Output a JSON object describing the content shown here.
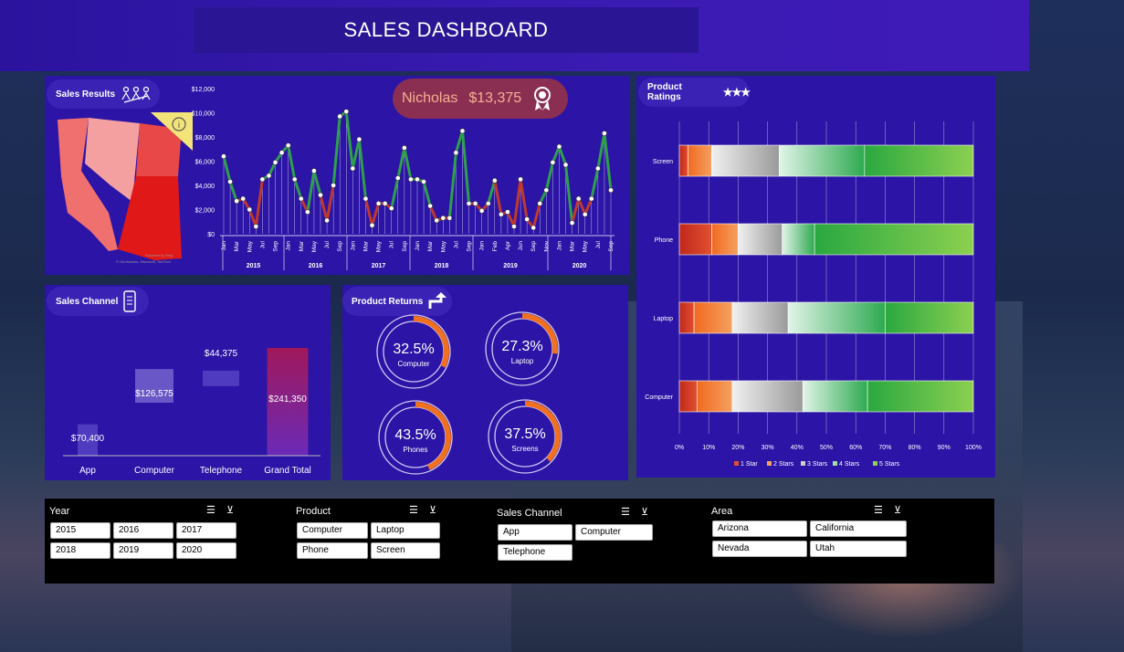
{
  "header": {
    "title": "SALES DASHBOARD"
  },
  "sales_results": {
    "title": "Sales Results",
    "top_performer": {
      "name": "Nicholas",
      "amount": "$13,375"
    },
    "map_credit": "© GeoNames, Microsoft, TomTom",
    "map_credit2": "Powered by Bing",
    "info_icon": "info-icon"
  },
  "chart_data": [
    {
      "type": "line",
      "title": "",
      "ylabel": "",
      "ylim": [
        0,
        12000
      ],
      "yticks": [
        "$0",
        "$2,000",
        "$4,000",
        "$6,000",
        "$8,000",
        "$10,000",
        "$12,000"
      ],
      "years": [
        "2015",
        "2016",
        "2017",
        "2018",
        "2019",
        "2020"
      ],
      "x": [
        "Jan",
        "Mar",
        "May",
        "Jul",
        "Sep",
        "Jan",
        "Mar",
        "May",
        "Jul",
        "Sep",
        "Jan",
        "Mar",
        "May",
        "Jul",
        "Sep",
        "Jan",
        "Mar",
        "May",
        "Jul",
        "Sep",
        "Jan",
        "Feb",
        "Apr",
        "Jun",
        "Sep",
        "Nov",
        "Jan",
        "Mar",
        "May",
        "Jul",
        "Sep"
      ],
      "values": [
        6400,
        4300,
        2700,
        2900,
        2000,
        600,
        4500,
        4800,
        5900,
        6700,
        7300,
        4500,
        2900,
        1800,
        5200,
        3200,
        1100,
        4000,
        9700,
        10100,
        5400,
        7800,
        2900,
        700,
        2500,
        2500,
        2100,
        4600,
        7100,
        4500,
        4500,
        4300,
        2300,
        1100,
        1300,
        1300,
        6700,
        8500,
        2500,
        2500,
        1900,
        2500,
        4400,
        1600,
        1800,
        600,
        4500,
        1200,
        500,
        2500,
        3600,
        5900,
        7200,
        5700,
        900,
        2900,
        1600,
        2900,
        5400,
        8300,
        3600
      ]
    },
    {
      "type": "bar",
      "title": "Sales Channel",
      "categories": [
        "App",
        "Computer",
        "Telephone",
        "Grand Total"
      ],
      "values": [
        70400,
        126575,
        44375,
        241350
      ],
      "labels": [
        "$70,400",
        "$126,575",
        "$44,375",
        "$241,350"
      ]
    },
    {
      "type": "pie",
      "title": "Product Returns",
      "series": [
        {
          "name": "Computer",
          "value": 32.5,
          "label": "32.5%"
        },
        {
          "name": "Laptop",
          "value": 27.3,
          "label": "27.3%"
        },
        {
          "name": "Phones",
          "value": 43.5,
          "label": "43.5%"
        },
        {
          "name": "Screens",
          "value": 37.5,
          "label": "37.5%"
        }
      ]
    },
    {
      "type": "bar",
      "title": "Product Ratings",
      "orientation": "horizontal-stacked-100",
      "categories": [
        "Screen",
        "Phone",
        "Laptop",
        "Computer"
      ],
      "xticks": [
        "0%",
        "10%",
        "20%",
        "30%",
        "40%",
        "50%",
        "60%",
        "70%",
        "80%",
        "90%",
        "100%"
      ],
      "series": [
        {
          "name": "1 Star",
          "values": [
            3,
            11,
            5,
            6
          ]
        },
        {
          "name": "2 Stars",
          "values": [
            8,
            9,
            13,
            12
          ]
        },
        {
          "name": "3 Stars",
          "values": [
            23,
            15,
            19,
            24
          ]
        },
        {
          "name": "4 Stars",
          "values": [
            29,
            11,
            33,
            22
          ]
        },
        {
          "name": "5 Stars",
          "values": [
            37,
            54,
            30,
            36
          ]
        }
      ],
      "legend_position": "bottom"
    }
  ],
  "sales_channel": {
    "title": "Sales Channel"
  },
  "product_returns": {
    "title": "Product Returns"
  },
  "product_ratings": {
    "title": "Product Ratings"
  },
  "colors": {
    "panel": "#2b14a6",
    "header": "#3a1bb3",
    "accent_orange": "#f07020",
    "line_green": "#2ea04a",
    "line_red": "#c0392b"
  },
  "slicers": [
    {
      "label": "Year",
      "items": [
        "2015",
        "2016",
        "2017",
        "2018",
        "2019",
        "2020"
      ]
    },
    {
      "label": "Product",
      "items": [
        "Computer",
        "Laptop",
        "Phone",
        "Screen"
      ]
    },
    {
      "label": "Sales Channel",
      "items": [
        "App",
        "Computer",
        "Telephone"
      ]
    },
    {
      "label": "Area",
      "items": [
        "Arizona",
        "California",
        "Nevada",
        "Utah"
      ]
    }
  ]
}
